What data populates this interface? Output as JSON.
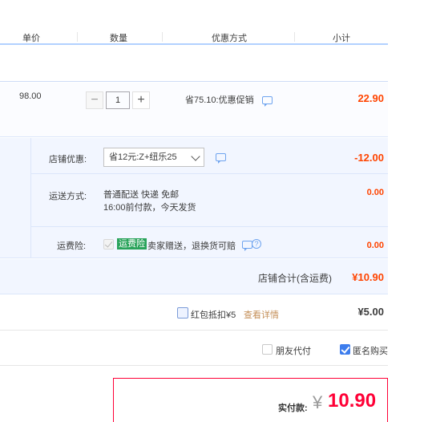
{
  "header": {
    "col_price": "单价",
    "col_qty": "数量",
    "col_discount": "优惠方式",
    "col_subtotal": "小计"
  },
  "item": {
    "unit_price": "98.00",
    "quantity": "1",
    "minus": "−",
    "plus": "+",
    "promo": "省75.10:优惠促销",
    "subtotal": "22.90"
  },
  "shop": {
    "coupon_label": "店铺优惠:",
    "coupon_selected": "省12元:Z+纽乐25",
    "coupon_amount": "-12.00",
    "shipping_label": "运送方式:",
    "shipping_line1": "普通配送 快递 免邮",
    "shipping_line2": "16:00前付款，今天发货",
    "shipping_amount": "0.00",
    "insurance_label": "运费险:",
    "insurance_badge": "运费险",
    "insurance_text": "卖家赠送，退换货可赔",
    "insurance_amount": "0.00",
    "total_label": "店铺合计(含运费)",
    "total_amount": "¥10.90"
  },
  "redpacket": {
    "label": "红包抵扣¥5",
    "link": "查看详情",
    "amount": "¥5.00"
  },
  "options": {
    "friend_pay": "朋友代付",
    "anonymous": "匿名购买"
  },
  "pay": {
    "label": "实付款:",
    "currency": "¥",
    "amount": "10.90"
  },
  "colors": {
    "price_red": "#ff4400",
    "pay_red": "#ff0036",
    "header_line": "#b2d1ff",
    "shop_bg": "#f2f6ff",
    "checkbox_blue": "#3d7ded"
  }
}
